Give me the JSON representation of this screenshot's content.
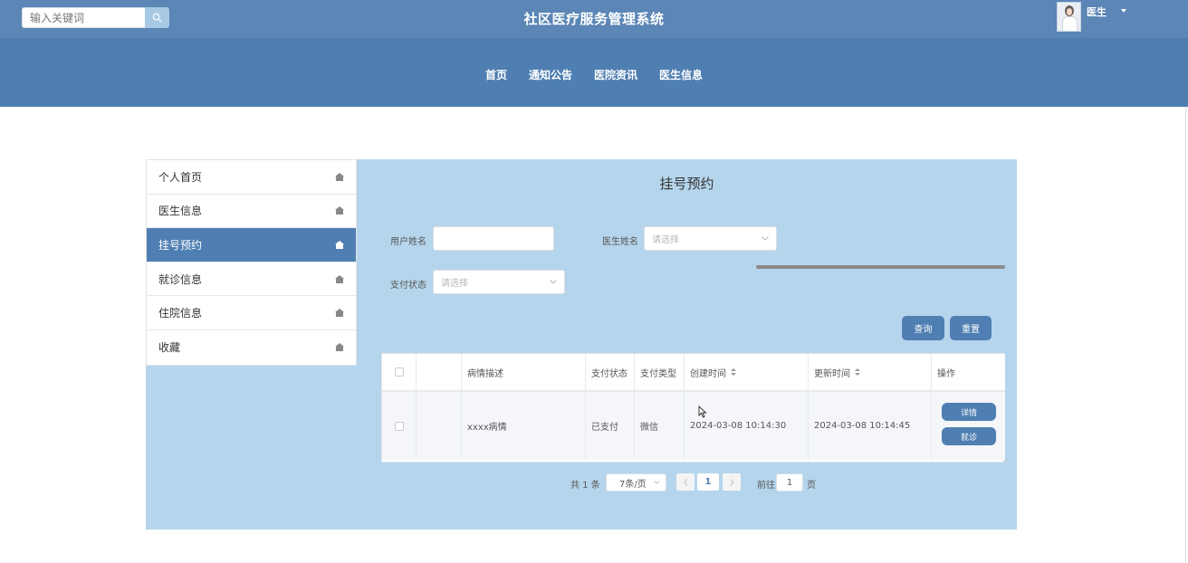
{
  "header": {
    "search_placeholder": "输入关键词",
    "title": "社区医疗服务管理系统",
    "user_name": "医生"
  },
  "nav": {
    "items": [
      "首页",
      "通知公告",
      "医院资讯",
      "医生信息"
    ]
  },
  "sidebar": {
    "items": [
      {
        "label": "个人首页",
        "active": false
      },
      {
        "label": "医生信息",
        "active": false
      },
      {
        "label": "挂号预约",
        "active": true
      },
      {
        "label": "就诊信息",
        "active": false
      },
      {
        "label": "住院信息",
        "active": false
      },
      {
        "label": "收藏",
        "active": false
      }
    ]
  },
  "main": {
    "title": "挂号预约",
    "filters": {
      "user_name_label": "用户姓名",
      "user_name_value": "",
      "doctor_name_label": "医生姓名",
      "doctor_name_placeholder": "请选择",
      "pay_status_label": "支付状态",
      "pay_status_placeholder": "请选择"
    },
    "buttons": {
      "query": "查询",
      "reset": "重置"
    },
    "table": {
      "headers": {
        "description": "病情描述",
        "pay_status": "支付状态",
        "pay_type": "支付类型",
        "created": "创建时间",
        "updated": "更新时间",
        "actions": "操作"
      },
      "rows": [
        {
          "description": "xxxx病情",
          "pay_status": "已支付",
          "pay_type": "微信",
          "created": "2024-03-08 10:14:30",
          "updated": "2024-03-08 10:14:45",
          "detail_label": "详情",
          "visit_label": "就诊"
        }
      ]
    },
    "pagination": {
      "total_text": "共 1 条",
      "page_size": "7条/页",
      "current_page": "1",
      "goto_label": "前往",
      "goto_value": "1",
      "page_suffix": "页"
    }
  },
  "colors": {
    "topbar": "#5b86b6",
    "navband": "#4f7fb2",
    "panel": "#b5d5ec",
    "accent": "#4f7fb2"
  }
}
